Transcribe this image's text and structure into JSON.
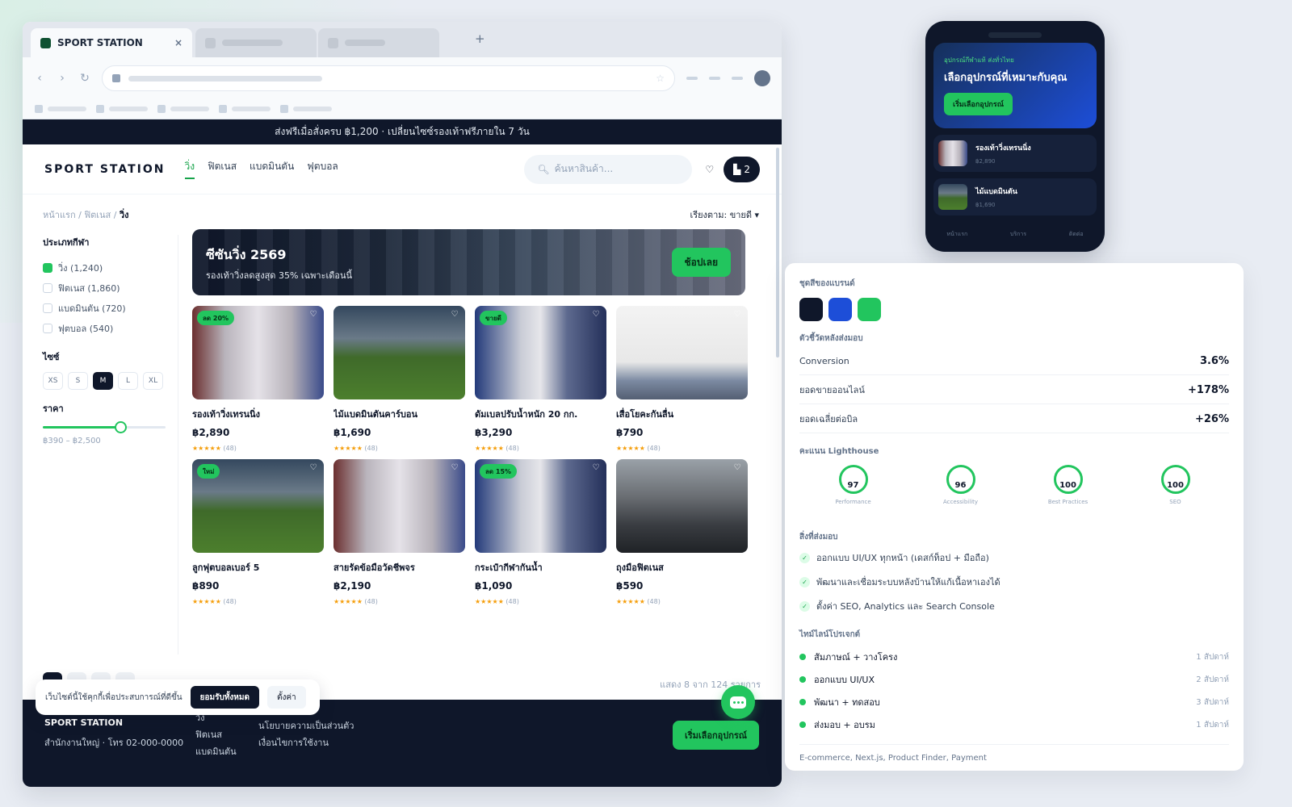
{
  "browser": {
    "tab_title": "SPORT STATION",
    "tab_close": "×",
    "new_tab": "+"
  },
  "site": {
    "announcement": "ส่งฟรีเมื่อสั่งครบ ฿1,200 · เปลี่ยนไซซ์รองเท้าฟรีภายใน 7 วัน",
    "logo": "SPORT STATION",
    "menu": [
      "วิ่ง",
      "ฟิตเนส",
      "แบดมินตัน",
      "ฟุตบอล"
    ],
    "search_placeholder": "ค้นหาสินค้า...",
    "cart_label": "2",
    "breadcrumb": {
      "home": "หน้าแรก /",
      "category": "ฟิตเนส /",
      "current": "วิ่ง"
    },
    "sort": "เรียงตาม: ขายดี ▾",
    "filters": {
      "sport_title": "ประเภทกีฬา",
      "sports": [
        {
          "label": "วิ่ง (1,240)",
          "checked": true
        },
        {
          "label": "ฟิตเนส (1,860)",
          "checked": false
        },
        {
          "label": "แบดมินตัน (720)",
          "checked": false
        },
        {
          "label": "ฟุตบอล (540)",
          "checked": false
        }
      ],
      "size_title": "ไซซ์",
      "sizes": [
        "XS",
        "S",
        "M",
        "L",
        "XL"
      ],
      "size_selected": "M",
      "price_title": "ราคา",
      "price_range": "฿390 – ฿2,500",
      "price_level": 0.63
    },
    "hero": {
      "title": "ซีซันวิ่ง 2569",
      "subtitle": "รองเท้าวิ่งลดสูงสุด 35% เฉพาะเดือนนี้",
      "button": "ช้อปเลย"
    },
    "products": [
      {
        "name": "รองเท้าวิ่งเทรนนิ่ง",
        "price": "฿2,890",
        "stars": "★★★★★",
        "reviews": "(48)",
        "badge": "ลด 20%",
        "img": "aisle"
      },
      {
        "name": "ไม้แบดมินตันคาร์บอน",
        "price": "฿1,690",
        "stars": "★★★★★",
        "reviews": "(48)",
        "badge": "",
        "img": "stadium"
      },
      {
        "name": "ดัมเบลปรับน้ำหนัก 20 กก.",
        "price": "฿3,290",
        "stars": "★★★★★",
        "reviews": "(48)",
        "badge": "ขายดี",
        "img": "shelf"
      },
      {
        "name": "เสื่อโยคะกันลื่น",
        "price": "฿790",
        "stars": "★★★★★",
        "reviews": "(48)",
        "badge": "",
        "img": "yoga"
      },
      {
        "name": "ลูกฟุตบอลเบอร์ 5",
        "price": "฿890",
        "stars": "★★★★★",
        "reviews": "(48)",
        "badge": "ใหม่",
        "img": "stadium"
      },
      {
        "name": "สายรัดข้อมือวัดชีพจร",
        "price": "฿2,190",
        "stars": "★★★★★",
        "reviews": "(48)",
        "badge": "",
        "img": "aisle"
      },
      {
        "name": "กระเป๋ากีฬากันน้ำ",
        "price": "฿1,090",
        "stars": "★★★★★",
        "reviews": "(48)",
        "badge": "ลด 15%",
        "img": "shelf"
      },
      {
        "name": "ถุงมือฟิตเนส",
        "price": "฿590",
        "stars": "★★★★★",
        "reviews": "(48)",
        "badge": "",
        "img": "gym"
      }
    ],
    "results": "แสดง 8 จาก 124 รายการ",
    "cookie": {
      "text": "เว็บไซต์นี้ใช้คุกกี้เพื่อประสบการณ์ที่ดีขึ้น",
      "accept": "ยอมรับทั้งหมด",
      "settings": "ตั้งค่า"
    },
    "footer": {
      "logo": "SPORT STATION",
      "address": "สำนักงานใหญ่ · โทร 02-000-0000",
      "links_sports": [
        "วิ่ง",
        "ฟิตเนส",
        "แบดมินตัน"
      ],
      "links_legal": [
        "นโยบายความเป็นส่วนตัว",
        "เงื่อนไขการใช้งาน"
      ],
      "cta": "เริ่มเลือกอุปกรณ์"
    }
  },
  "phone": {
    "kicker": "อุปกรณ์กีฬาแท้ ส่งทั่วไทย",
    "title": "เลือกอุปกรณ์ที่เหมาะกับคุณ",
    "button": "เริ่มเลือกอุปกรณ์",
    "items": [
      {
        "name": "รองเท้าวิ่งเทรนนิ่ง",
        "price": "฿2,890"
      },
      {
        "name": "ไม้แบดมินตัน",
        "price": "฿1,690"
      }
    ],
    "nav": [
      "หน้าแรก",
      "บริการ",
      "ติดต่อ"
    ]
  },
  "panel": {
    "brand_title": "ชุดสีของแบรนด์",
    "brand_colors": [
      "#0f172a",
      "#1d4ed8",
      "#22c55e"
    ],
    "metrics_title": "ตัวชี้วัดหลังส่งมอบ",
    "metrics": [
      {
        "label": "Conversion",
        "value": "3.6%"
      },
      {
        "label": "ยอดขายออนไลน์",
        "value": "+178%"
      },
      {
        "label": "ยอดเฉลี่ยต่อบิล",
        "value": "+26%"
      }
    ],
    "lighthouse_title": "คะแนน Lighthouse",
    "lighthouse": [
      {
        "label": "Performance",
        "score": "97"
      },
      {
        "label": "Accessibility",
        "score": "96"
      },
      {
        "label": "Best Practices",
        "score": "100"
      },
      {
        "label": "SEO",
        "score": "100"
      }
    ],
    "deliverables_title": "สิ่งที่ส่งมอบ",
    "deliverables": [
      "ออกแบบ UI/UX ทุกหน้า (เดสก์ท็อป + มือถือ)",
      "พัฒนาและเชื่อมระบบหลังบ้านให้แก้เนื้อหาเองได้",
      "ตั้งค่า SEO, Analytics และ Search Console"
    ],
    "timeline_title": "ไทม์ไลน์โปรเจกต์",
    "timeline": [
      {
        "label": "สัมภาษณ์ + วางโครง",
        "weeks": "1 สัปดาห์"
      },
      {
        "label": "ออกแบบ UI/UX",
        "weeks": "2 สัปดาห์"
      },
      {
        "label": "พัฒนา + ทดสอบ",
        "weeks": "3 สัปดาห์"
      },
      {
        "label": "ส่งมอบ + อบรม",
        "weeks": "1 สัปดาห์"
      }
    ],
    "tags": "E-commerce, Next.js, Product Finder, Payment"
  }
}
